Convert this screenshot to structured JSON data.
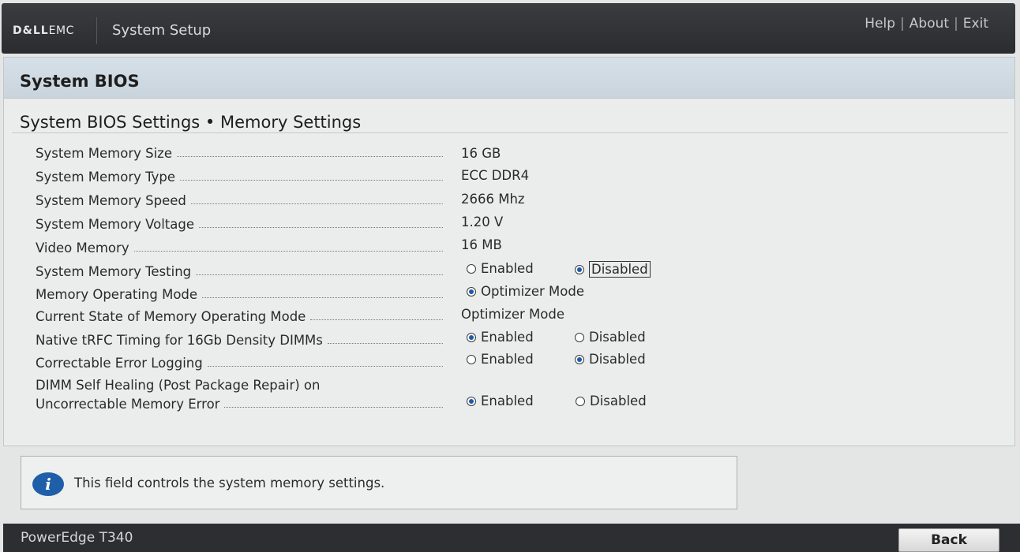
{
  "topbar": {
    "logo_dell": "D&LL",
    "logo_emc": "EMC",
    "title": "System Setup",
    "links": {
      "help": "Help",
      "about": "About",
      "exit": "Exit",
      "separator": "|"
    }
  },
  "panel": {
    "header": "System BIOS",
    "breadcrumb": "System BIOS Settings • Memory Settings"
  },
  "settings": {
    "memory_size": {
      "label": "System Memory Size",
      "value": "16 GB"
    },
    "memory_type": {
      "label": "System Memory Type",
      "value": "ECC DDR4"
    },
    "memory_speed": {
      "label": "System Memory Speed",
      "value": "2666 Mhz"
    },
    "memory_voltage": {
      "label": "System Memory Voltage",
      "value": "1.20 V"
    },
    "video_memory": {
      "label": "Video Memory",
      "value": "16 MB"
    },
    "memory_testing": {
      "label": "System Memory Testing",
      "opt1": "Enabled",
      "opt2": "Disabled",
      "selected": "Disabled"
    },
    "operating_mode": {
      "label": "Memory Operating Mode",
      "opt1": "Optimizer Mode",
      "selected": "Optimizer Mode"
    },
    "current_mode": {
      "label": "Current State of Memory Operating Mode",
      "value": "Optimizer Mode"
    },
    "native_trfc": {
      "label": "Native tRFC Timing for 16Gb Density DIMMs",
      "opt1": "Enabled",
      "opt2": "Disabled",
      "selected": "Enabled"
    },
    "error_logging": {
      "label": "Correctable Error Logging",
      "opt1": "Enabled",
      "opt2": "Disabled",
      "selected": "Disabled"
    },
    "self_healing": {
      "label_line1": "DIMM Self Healing (Post Package Repair) on",
      "label_line2": "Uncorrectable Memory Error",
      "opt1": "Enabled",
      "opt2": "Disabled",
      "selected": "Enabled"
    }
  },
  "info": {
    "icon": "info-icon",
    "text": "This field controls the system memory settings."
  },
  "footer": {
    "model": "PowerEdge T340",
    "back": "Back"
  }
}
